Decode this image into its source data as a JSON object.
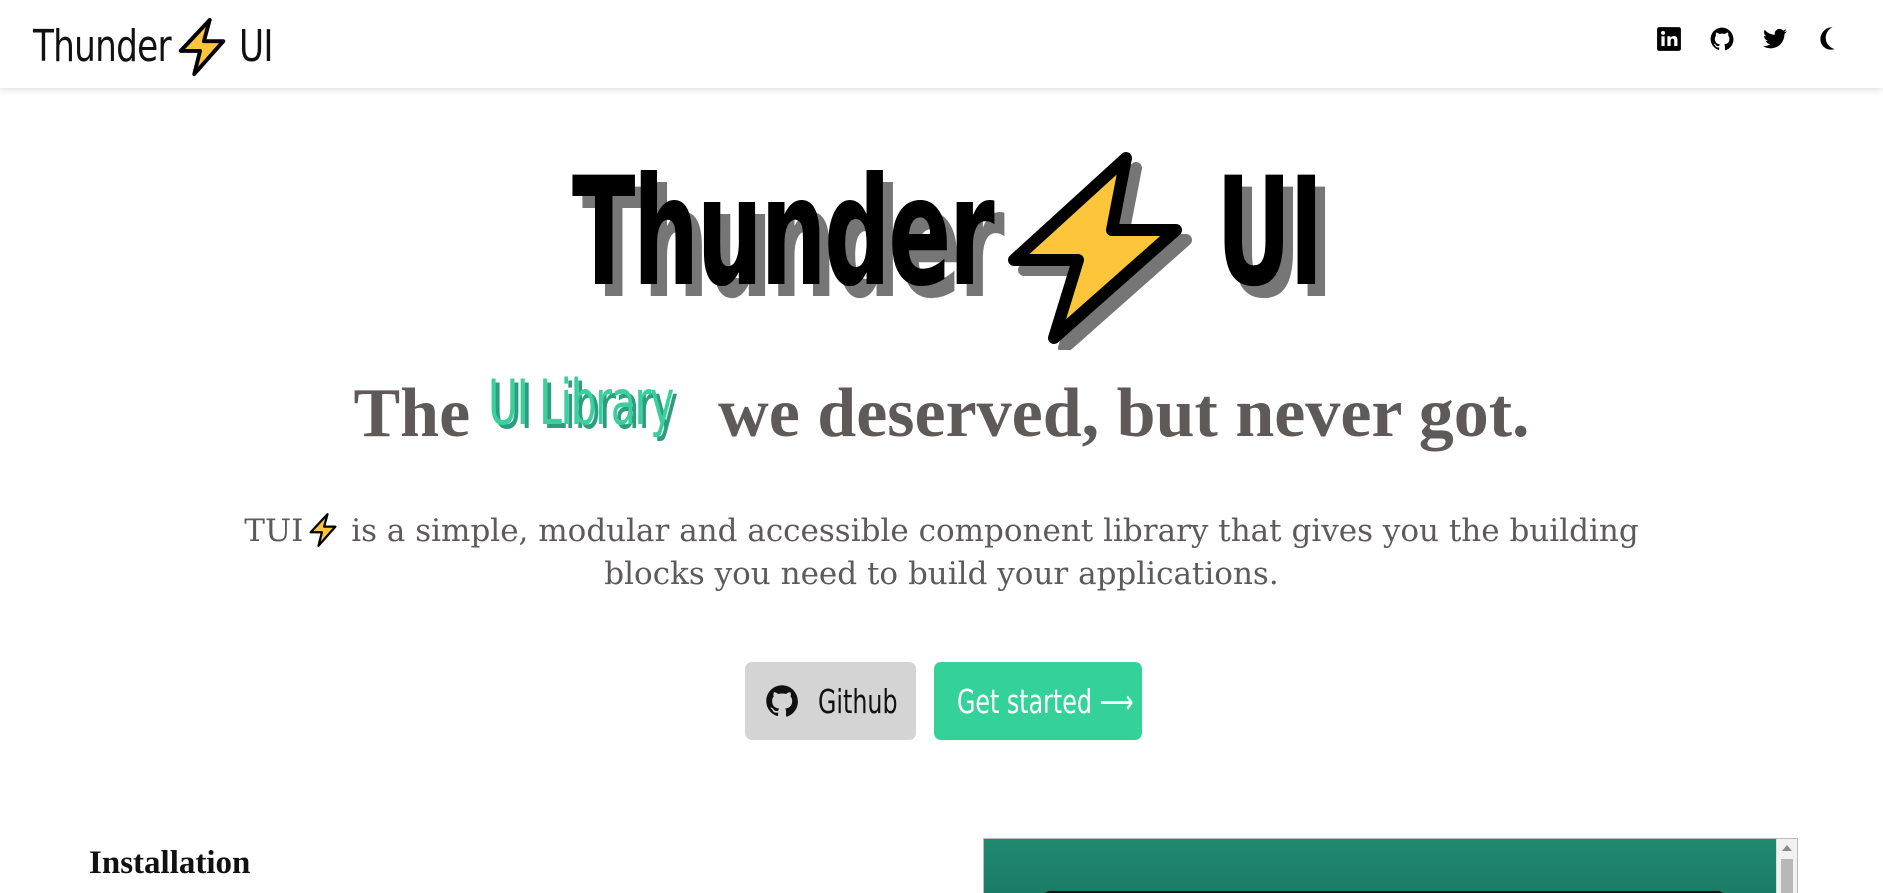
{
  "nav": {
    "brand_word_1": "Thunder",
    "brand_word_2": "UI",
    "icons": [
      "linkedin-icon",
      "github-icon",
      "twitter-icon",
      "moon-icon"
    ]
  },
  "hero": {
    "logo_word_1": "Thunder",
    "logo_word_2": "UI",
    "tagline_before": "The ",
    "tagline_highlight": "UI Library",
    "tagline_after": " we deserved, but never got.",
    "description_prefix": "TUI",
    "description_text": " is a simple, modular and accessible component library that gives you the building blocks you need to build your applications."
  },
  "buttons": {
    "github_label": "Github",
    "get_started_label": "Get started ⟶"
  },
  "installation": {
    "heading": "Installation"
  },
  "colors": {
    "accent_green": "#35d19b",
    "bolt_yellow": "#fcc53a",
    "text_gray": "#5e5a5a",
    "button_gray": "#d4d4d4"
  }
}
